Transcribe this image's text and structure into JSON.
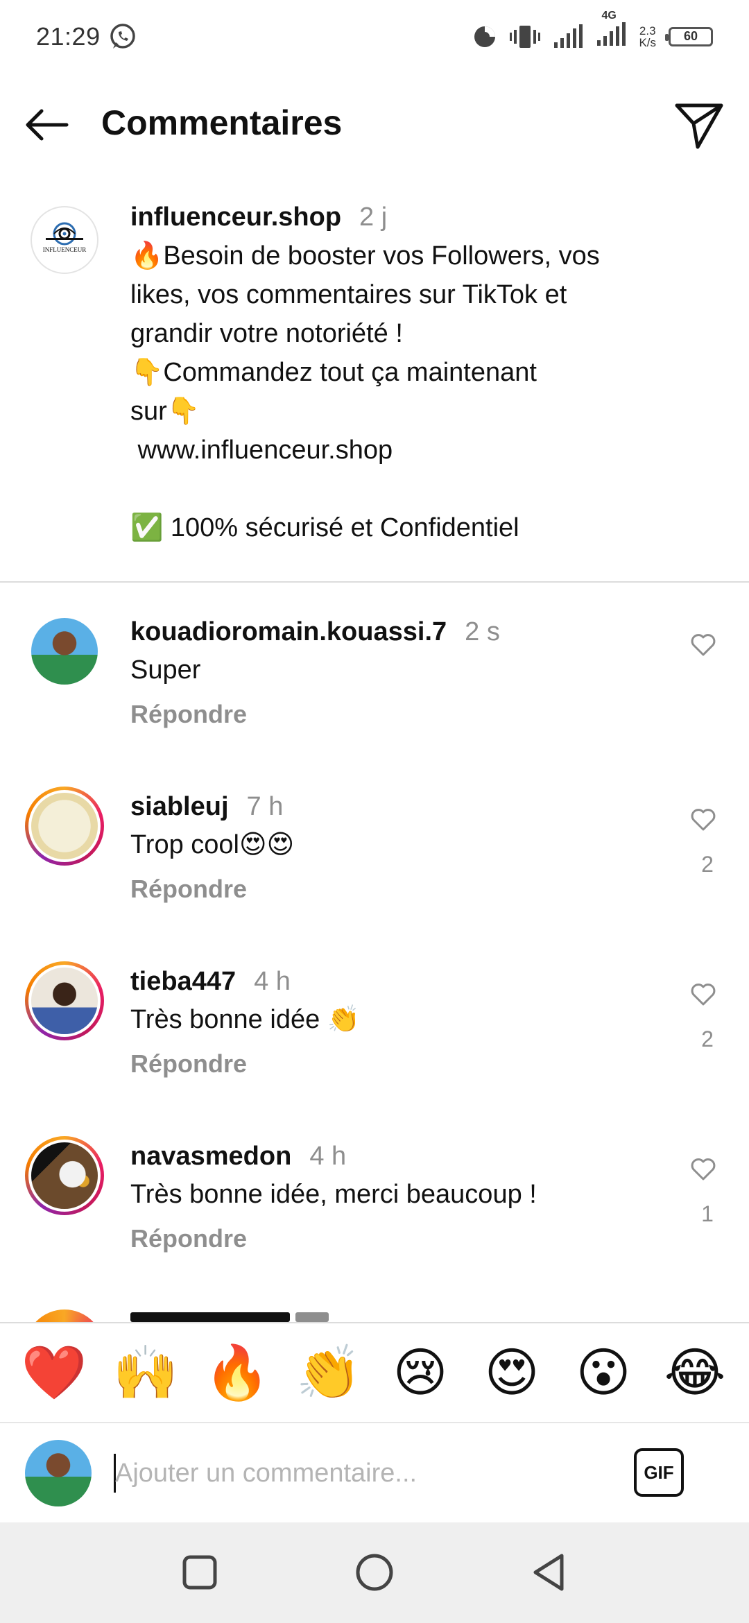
{
  "status_bar": {
    "time": "21:29",
    "network": "4G",
    "speed_value": "2.3",
    "speed_unit": "K/s",
    "battery": "60"
  },
  "header": {
    "title": "Commentaires"
  },
  "caption": {
    "username": "influenceur.shop",
    "time": "2 j",
    "logo_text": "INFLUENCEUR",
    "lines": [
      "🔥Besoin de booster vos Followers, vos",
      "likes, vos commentaires sur TikTok et",
      "grandir votre notoriété !",
      "👇Commandez tout ça maintenant",
      "sur👇",
      " www.influenceur.shop",
      "",
      "✅ 100% sécurisé et Confidentiel"
    ]
  },
  "comments": [
    {
      "username": "kouadioromain.kouassi.7",
      "time": "2 s",
      "text": "Super",
      "reply": "Répondre",
      "likes": ""
    },
    {
      "username": "siableuj",
      "time": "7 h",
      "text": "Trop cool😍😍",
      "reply": "Répondre",
      "likes": "2"
    },
    {
      "username": "tieba447",
      "time": "4 h",
      "text": "Très bonne idée 👏",
      "reply": "Répondre",
      "likes": "2"
    },
    {
      "username": "navasmedon",
      "time": "4 h",
      "text": "Très bonne idée, merci beaucoup !",
      "reply": "Répondre",
      "likes": "1"
    }
  ],
  "emoji_bar": [
    "❤️",
    "🙌",
    "🔥",
    "👏",
    "😢",
    "😍",
    "😮",
    "😂"
  ],
  "input": {
    "placeholder": "Ajouter un commentaire...",
    "gif_label": "GIF"
  },
  "colors": {
    "accent_ring_start": "#f9a825",
    "accent_ring_end": "#c2185b",
    "muted_text": "#8e8e8e"
  },
  "icons": [
    "whatsapp-icon",
    "data-usage-icon",
    "vibrate-icon",
    "signal-icon",
    "battery-icon",
    "back-arrow-icon",
    "send-icon",
    "heart-outline-icon",
    "square-nav-icon",
    "circle-nav-icon",
    "triangle-nav-icon"
  ]
}
